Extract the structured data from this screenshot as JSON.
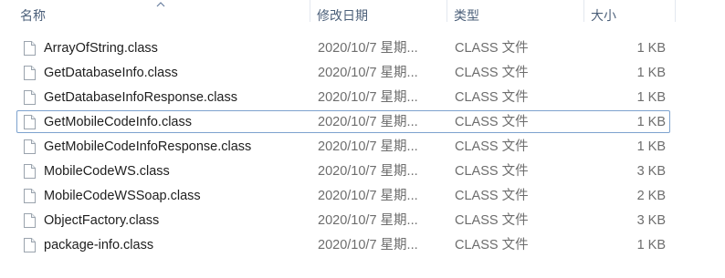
{
  "columns": {
    "name": "名称",
    "modified": "修改日期",
    "type": "类型",
    "size": "大小"
  },
  "files": [
    {
      "name": "ArrayOfString.class",
      "modified": "2020/10/7 星期...",
      "type": "CLASS 文件",
      "size": "1 KB"
    },
    {
      "name": "GetDatabaseInfo.class",
      "modified": "2020/10/7 星期...",
      "type": "CLASS 文件",
      "size": "1 KB"
    },
    {
      "name": "GetDatabaseInfoResponse.class",
      "modified": "2020/10/7 星期...",
      "type": "CLASS 文件",
      "size": "1 KB"
    },
    {
      "name": "GetMobileCodeInfo.class",
      "modified": "2020/10/7 星期...",
      "type": "CLASS 文件",
      "size": "1 KB"
    },
    {
      "name": "GetMobileCodeInfoResponse.class",
      "modified": "2020/10/7 星期...",
      "type": "CLASS 文件",
      "size": "1 KB"
    },
    {
      "name": "MobileCodeWS.class",
      "modified": "2020/10/7 星期...",
      "type": "CLASS 文件",
      "size": "3 KB"
    },
    {
      "name": "MobileCodeWSSoap.class",
      "modified": "2020/10/7 星期...",
      "type": "CLASS 文件",
      "size": "2 KB"
    },
    {
      "name": "ObjectFactory.class",
      "modified": "2020/10/7 星期...",
      "type": "CLASS 文件",
      "size": "3 KB"
    },
    {
      "name": "package-info.class",
      "modified": "2020/10/7 星期...",
      "type": "CLASS 文件",
      "size": "1 KB"
    }
  ],
  "selected_index": 3,
  "sort": {
    "column": "name",
    "direction": "ascending",
    "icon": "sort-ascending-icon"
  },
  "colors": {
    "header_text": "#4c607a",
    "selection_border": "#7da2ce",
    "secondary_text": "#6d6d6d"
  }
}
